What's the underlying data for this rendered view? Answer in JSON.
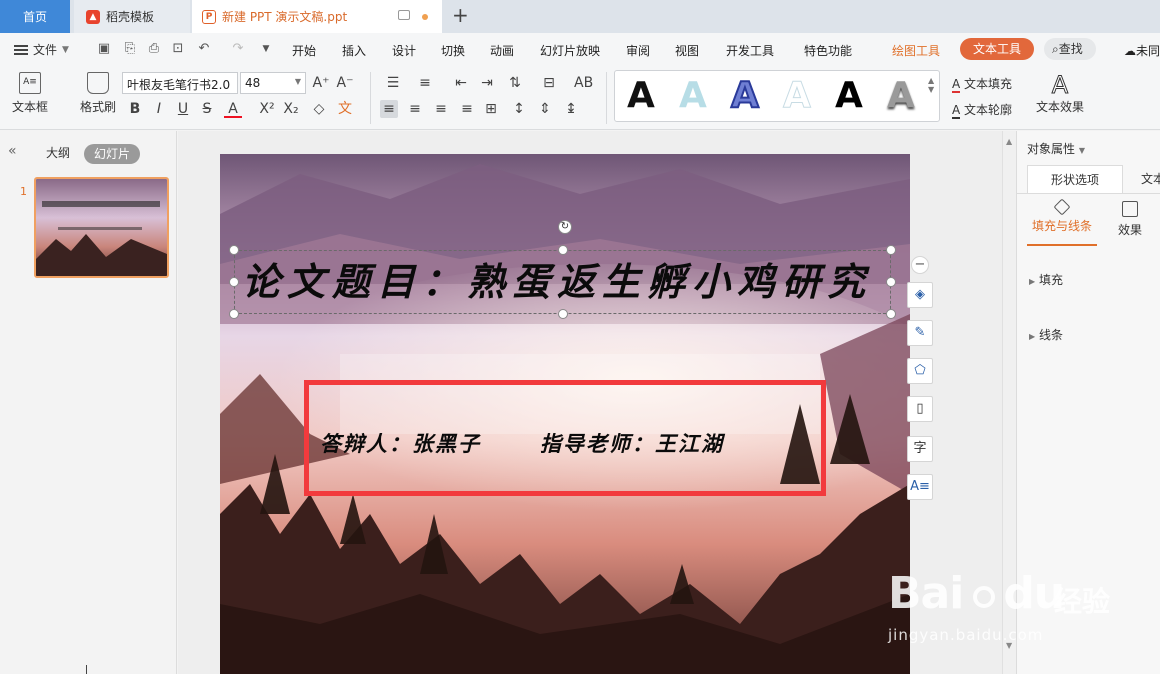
{
  "tabs": {
    "home": "首页",
    "template": "稻壳模板",
    "document": "新建 PPT 演示文稿.ppt",
    "add": "+"
  },
  "menu": {
    "file": "文件",
    "items": [
      "开始",
      "插入",
      "设计",
      "切换",
      "动画",
      "幻灯片放映",
      "审阅",
      "视图",
      "开发工具",
      "特色功能"
    ],
    "drawing_tools": "绘图工具",
    "text_tools": "文本工具",
    "search": "查找",
    "cloud": "未同"
  },
  "ribbon": {
    "textbox": "文本框",
    "format_painter": "格式刷",
    "font_name": "叶根友毛笔行书2.0",
    "font_size": "48",
    "text_fill": "文本填充",
    "text_outline": "文本轮廓",
    "text_effects": "文本效果",
    "style_glyph": "A"
  },
  "left_pane": {
    "outline_tab": "大纲",
    "slides_tab": "幻灯片",
    "slide_number": "1"
  },
  "slide": {
    "title": "论文题目：熟蛋返生孵小鸡研究",
    "defender": "答辩人：张黑子",
    "advisor": "指导老师：王江湖"
  },
  "right_pane": {
    "header": "对象属性",
    "tab_shape": "形状选项",
    "tab_text": "文本",
    "sub_fill_line": "填充与线条",
    "sub_effects": "效果",
    "row_fill": "填充",
    "row_line": "线条"
  },
  "watermark": {
    "brand": "Bai",
    "brand2": "du",
    "cn": "经验",
    "url": "jingyan.baidu.com"
  },
  "colors": {
    "accent": "#e2683b",
    "home_tab": "#3f88d8",
    "highlight_rect": "#f23a3d"
  }
}
